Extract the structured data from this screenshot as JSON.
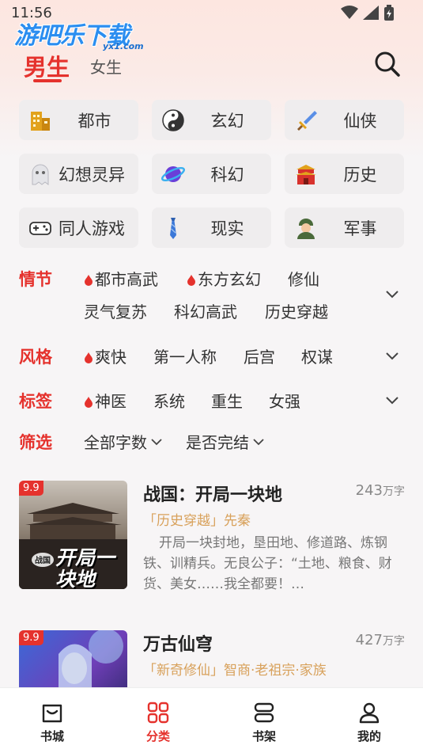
{
  "status": {
    "time": "11:56"
  },
  "logo": {
    "main": "游吧乐下载",
    "sub": "yx1.com"
  },
  "header": {
    "tab_male": "男生",
    "tab_female": "女生"
  },
  "genres": [
    {
      "label": "都市",
      "icon": "city-building-icon"
    },
    {
      "label": "玄幻",
      "icon": "yin-yang-icon"
    },
    {
      "label": "仙侠",
      "icon": "sword-icon"
    },
    {
      "label": "幻想灵异",
      "icon": "ghost-icon"
    },
    {
      "label": "科幻",
      "icon": "planet-icon"
    },
    {
      "label": "历史",
      "icon": "palace-icon"
    },
    {
      "label": "同人游戏",
      "icon": "gamepad-icon"
    },
    {
      "label": "现实",
      "icon": "necktie-icon"
    },
    {
      "label": "军事",
      "icon": "soldier-icon"
    }
  ],
  "filters": {
    "plot": {
      "title": "情节",
      "items": [
        "都市高武",
        "东方玄幻",
        "修仙",
        "灵气复苏",
        "科幻高武",
        "历史穿越"
      ]
    },
    "style": {
      "title": "风格",
      "items": [
        "爽快",
        "第一人称",
        "后宫",
        "权谋"
      ]
    },
    "tags": {
      "title": "标签",
      "items": [
        "神医",
        "系统",
        "重生",
        "女强"
      ]
    },
    "screen": {
      "title": "筛选",
      "items": [
        "全部字数",
        "是否完结"
      ]
    }
  },
  "books": [
    {
      "badge": "9.9",
      "title": "战国：开局一块地",
      "words_num": "243",
      "words_unit": "万字",
      "tag": "「历史穿越」",
      "sub": "先秦",
      "desc": "开局一块封地，垦田地、修道路、炼钢铁、训精兵。无良公子：“土地、粮食、财货、美女……我全都要！…",
      "cover_text": "开局一块地"
    },
    {
      "badge": "9.9",
      "title": "万古仙穹",
      "words_num": "427",
      "words_unit": "万字",
      "tag": "「新奇修仙」",
      "sub": "智商·老祖宗·家族",
      "desc": "",
      "cover_text": ""
    }
  ],
  "nav": [
    {
      "label": "书城",
      "icon": "bookstore-icon"
    },
    {
      "label": "分类",
      "icon": "category-grid-icon"
    },
    {
      "label": "书架",
      "icon": "bookshelf-icon"
    },
    {
      "label": "我的",
      "icon": "profile-icon"
    }
  ],
  "colors": {
    "accent": "#e5322d",
    "tag": "#d8a15b",
    "logo": "#2b8ef0"
  }
}
